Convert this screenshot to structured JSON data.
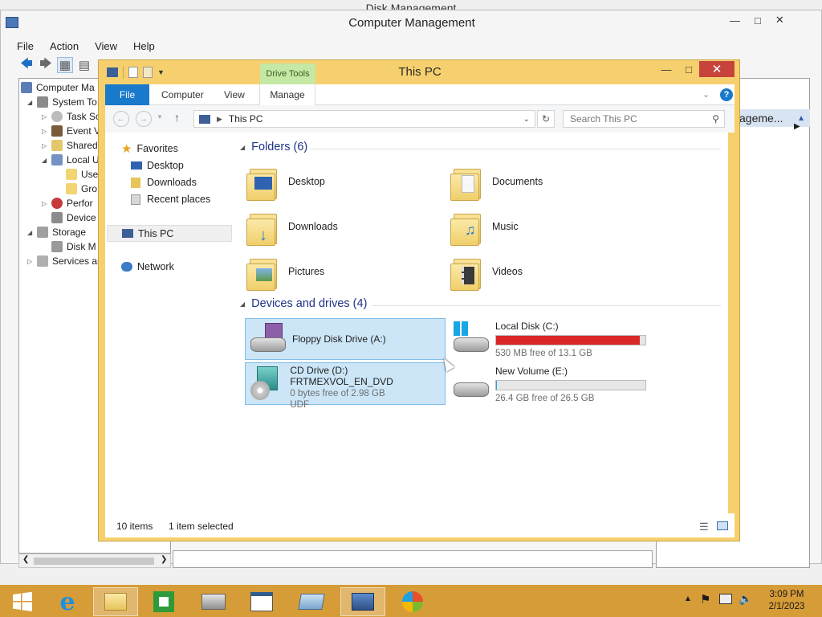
{
  "back_window": {
    "title": "Disk Management"
  },
  "cm": {
    "title": "Computer Management",
    "menu": [
      "File",
      "Action",
      "View",
      "Help"
    ],
    "tree": [
      {
        "label": "Computer Ma",
        "icon": "computer-icon"
      },
      {
        "label": "System To",
        "icon": "tools-icon"
      },
      {
        "label": "Task Sc",
        "icon": "clock-icon"
      },
      {
        "label": "Event V",
        "icon": "event-icon"
      },
      {
        "label": "Shared",
        "icon": "shared-folder-icon"
      },
      {
        "label": "Local U",
        "icon": "users-icon"
      },
      {
        "label": "Use",
        "icon": "folder-icon"
      },
      {
        "label": "Gro",
        "icon": "folder-icon"
      },
      {
        "label": "Perfor",
        "icon": "performance-icon"
      },
      {
        "label": "Device",
        "icon": "device-icon"
      },
      {
        "label": "Storage",
        "icon": "storage-icon"
      },
      {
        "label": "Disk M",
        "icon": "disk-icon"
      },
      {
        "label": "Services an",
        "icon": "services-icon"
      }
    ],
    "actions_header": "ageme..."
  },
  "explorer": {
    "title": "This PC",
    "ribbon_context": "Drive Tools",
    "tabs": {
      "file": "File",
      "computer": "Computer",
      "view": "View",
      "manage": "Manage"
    },
    "address": "This PC",
    "search_placeholder": "Search This PC",
    "nav": {
      "favorites": "Favorites",
      "desktop": "Desktop",
      "downloads": "Downloads",
      "recent": "Recent places",
      "thispc": "This PC",
      "network": "Network"
    },
    "folders_header": "Folders (6)",
    "folders": [
      "Desktop",
      "Documents",
      "Downloads",
      "Music",
      "Pictures",
      "Videos"
    ],
    "drives_header": "Devices and drives (4)",
    "drives": {
      "floppy": {
        "name": "Floppy Disk Drive (A:)"
      },
      "local_c": {
        "name": "Local Disk (C:)",
        "free": "530 MB free of 13.1 GB",
        "used_fraction": 0.96,
        "bar_color": "#da2626"
      },
      "cd": {
        "name": "CD Drive (D:) FRTMEXVOL_EN_DVD",
        "free": "0 bytes free of 2.98 GB",
        "fs": "UDF"
      },
      "volume_e": {
        "name": "New Volume (E:)",
        "free": "26.4 GB free of 26.5 GB",
        "used_fraction": 0.004,
        "bar_color": "#26a0da"
      }
    },
    "status": {
      "items": "10 items",
      "selected": "1 item selected"
    }
  },
  "taskbar": {
    "time": "3:09 PM",
    "date": "2/1/2023"
  }
}
